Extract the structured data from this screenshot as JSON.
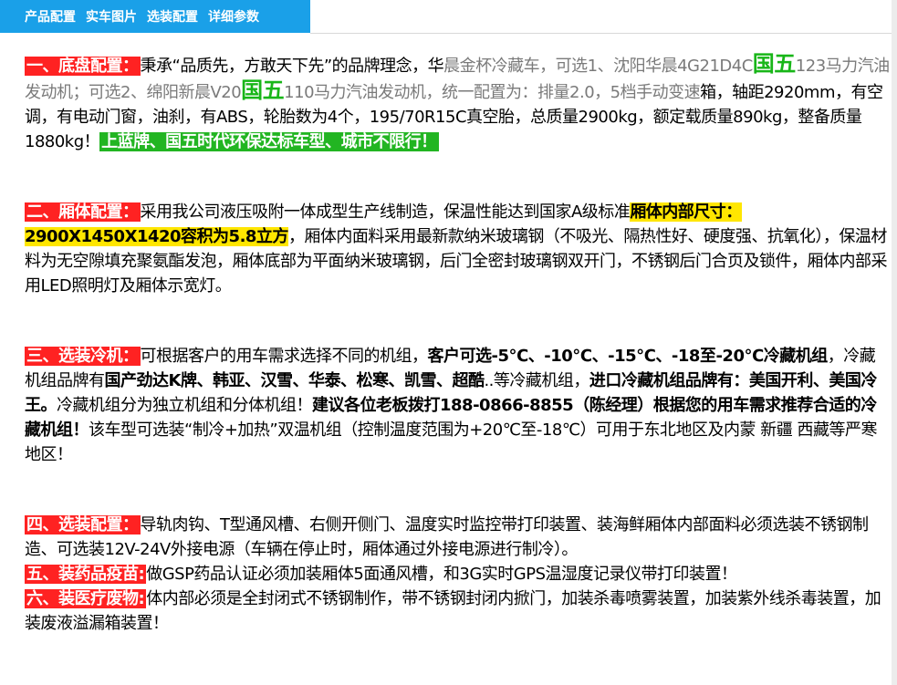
{
  "tabs": [
    "产品配置",
    "实车图片",
    "选装配置",
    "详细参数"
  ],
  "s1": {
    "label": "一、底盘配置：",
    "t1": "秉承“品质先，方敢天下先”的品牌理念，华",
    "t2": "晨金杯冷藏车，可选1、沈阳华晨4G21D4C",
    "gw": "国五",
    "t3": "123马力汽油发动机；可选2、绵阳新晨V20",
    "t4": "110马力汽油发动机，统一配置为：排量2.0，5档手动变速",
    "t5": "箱，轴距2920mm，有空调，有电动门窗，油刹，有ABS，轮胎数为4个，195/70R15C真空胎，总质量2900kg，额定载质量890kg，整备质量1880kg！",
    "hl": "上蓝牌、国五时代环保达标车型、城市不限行！"
  },
  "s2": {
    "label": "二、厢体配置：",
    "t1": "采用我公司液压吸附一体成型生产线制造，保温性能达到国家A级标准",
    "hl": "厢体内部尺寸：2900X1450X1420容积为5.8立方",
    "t2": "，厢体内面料采用最新款纳米玻璃钢（不吸光、隔热性好、硬度强、抗氧化），保温材料为无空隙填充聚氨酯发泡，厢体底部为平面纳米玻璃钢，后门全密封玻璃钢双开门，不锈钢后门合页及锁件，厢体内部采用LED照明灯及厢体示宽灯。"
  },
  "s3": {
    "label": "三、选装冷机：",
    "t1": "可根据客户的用车需求选择不同的机组，",
    "b1": "客户可选-5℃、-10℃、-15℃、-18至-20℃冷藏机组",
    "t2": "，冷藏机组品牌有",
    "b2": "国产劲达K牌、韩亚、汉雪、华泰、松寒、凯雪、超酷",
    "t3": "..等冷藏机组，",
    "b3": "进口冷藏机组品牌有：美国开利、美国冷王。",
    "t4": "冷藏机组分为独立机组和分体机组！",
    "b4": "建议各位老板拨打188-0866-8855（陈经理）根据您的用车需求推荐合适的冷藏机组！",
    "t5": "该车型可选装“制冷+加热”双温机组（控制温度范围为+20℃至-18℃）可用于东北地区及内蒙 新疆 西藏等严寒地区！"
  },
  "s4": {
    "label": "四、选装配置：",
    "t1": "导轨肉钩、T型通风槽、右侧开侧门、温度实时监控带打印装置、装海鲜厢体内部面料必须选装不锈钢制造、可选装12V-24V外接电源（车辆在停止时，厢体通过外接电源进行制冷）。"
  },
  "s5": {
    "label": "五、装药品疫苗:",
    "t1": "做GSP药品认证必须加装厢体5面通风槽，和3G实时GPS温湿度记录仪带打印装置！"
  },
  "s6": {
    "label": "六、装医疗废物:",
    "t1": "体内部必须是全封闭式不锈钢制作，带不锈钢封闭内掀门，加装杀毒喷雾装置，加装紫外线杀毒装置，加装废液溢漏箱装置！"
  }
}
